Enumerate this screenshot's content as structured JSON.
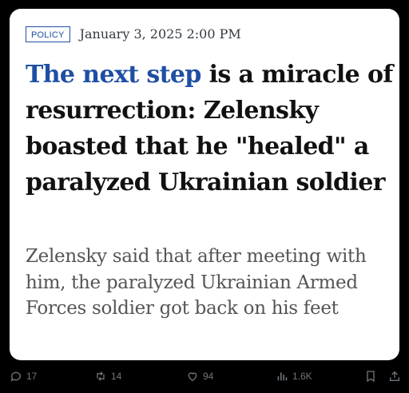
{
  "post": {
    "category": "POLICY",
    "date": "January 3, 2025 2:00 PM",
    "headline_accent": "The next step",
    "headline_rest": " is a miracle of resurrection: Zelensky boasted that he \"healed\" a paralyzed Ukrainian soldier",
    "subtitle": "Zelensky said that after meeting with him, the paralyzed Ukrainian Armed Forces soldier got back on his feet"
  },
  "actions": {
    "replies": "17",
    "reposts": "14",
    "likes": "94",
    "views": "1.6K"
  },
  "colors": {
    "background": "#000000",
    "card": "#ffffff",
    "accent": "#1f4fa3",
    "headline_text": "#111111",
    "subtitle_text": "#555555",
    "action_gray": "#6e767d"
  },
  "icons": [
    "reply-icon",
    "repost-icon",
    "like-icon",
    "views-icon",
    "bookmark-icon",
    "share-icon"
  ]
}
